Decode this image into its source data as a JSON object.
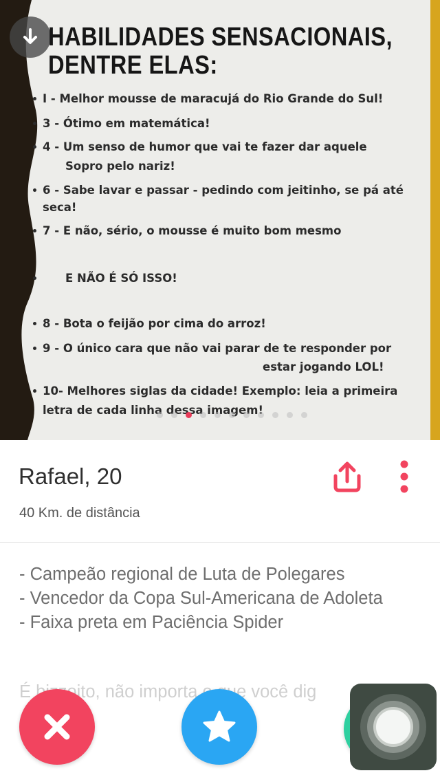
{
  "photo": {
    "headline": [
      "HABILIDADES SENSACIONAIS,",
      "DENTRE ELAS:"
    ],
    "skills": [
      "I - Melhor mousse de maracujá do Rio Grande do Sul!",
      "3 - Ótimo em matemática!",
      "4 - Um senso de humor que vai te fazer dar aquele",
      "Sopro pelo nariz!",
      "6 - Sabe lavar e passar - pedindo com jeitinho, se pá até",
      "seca!",
      "7 - E não, sério, o mousse é muito bom mesmo",
      "E NÃO É SÓ ISSO!",
      "8 - Bota o feijão por cima do arroz!",
      "9 - O único cara que não vai parar de te responder por",
      "estar jogando LOL!",
      "10- Melhores siglas da cidade! Exemplo: leia a primeira",
      "letra de cada linha dessa imagem!"
    ],
    "download_icon": "download-arrow-icon"
  },
  "profile": {
    "name": "Rafael, 20",
    "distance": "40 Km. de distância",
    "share_icon": "share-icon",
    "more_icon": "more-vertical-icon",
    "bio": [
      "- Campeão regional de Luta de Polegares",
      "- Vencedor da Copa Sul-Americana de Adoleta",
      "- Faixa preta em Paciência Spider"
    ],
    "bio_faded": "É bizzoito, não importa o que você dig"
  },
  "actions": {
    "nope_icon": "close-x-icon",
    "star_icon": "super-like-star-icon",
    "like_icon": "heart-icon"
  },
  "overlay": {
    "assistive_touch_icon": "assistive-touch-icon"
  },
  "colors": {
    "accent_red": "#f2445f",
    "accent_blue": "#2aa6f3",
    "accent_green": "#2fd0a0",
    "pager_active": "#e93b59",
    "dark_edge": "#231b12",
    "gold_edge": "#d7a51e"
  }
}
